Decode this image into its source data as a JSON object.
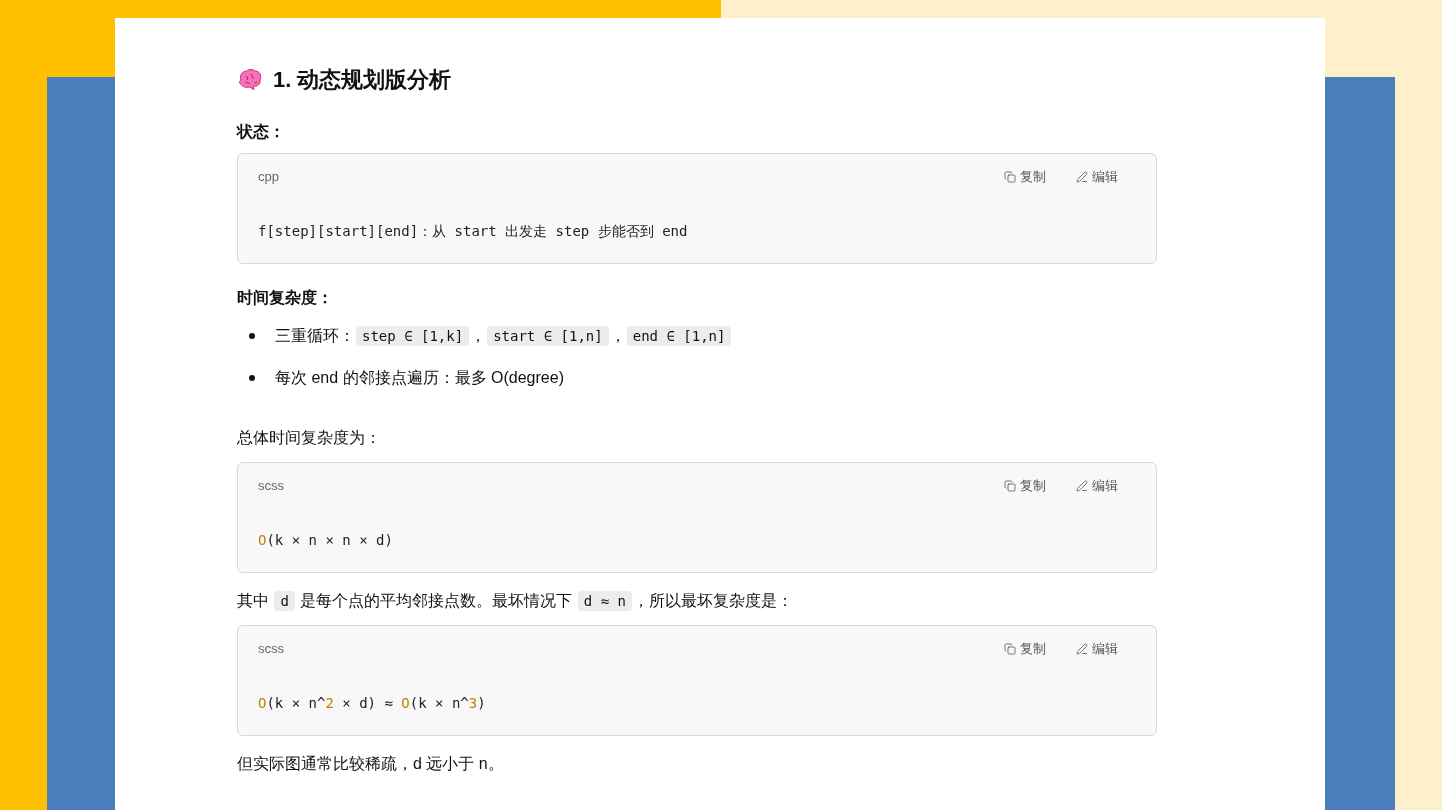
{
  "document": {
    "blocks": [
      {
        "kind": "heading",
        "text": "1. 动态规划版分析"
      },
      {
        "kind": "label",
        "text": "状态："
      },
      {
        "kind": "code",
        "language": "cpp",
        "actions": [
          "复制",
          "编辑"
        ],
        "tokens": [
          {
            "kind": "plain",
            "text": "f[step][start][end]：从 start 出发走 step 步能否到 end"
          }
        ]
      },
      {
        "kind": "label",
        "text": "时间复杂度："
      },
      {
        "kind": "bullets",
        "items": [
          [
            {
              "kind": "text",
              "text": "三重循环："
            },
            {
              "kind": "code",
              "text": "step ∈ [1,k]"
            },
            {
              "kind": "text",
              "text": "，"
            },
            {
              "kind": "code",
              "text": "start ∈ [1,n]"
            },
            {
              "kind": "text",
              "text": "，"
            },
            {
              "kind": "code",
              "text": "end ∈ [1,n]"
            }
          ],
          [
            {
              "kind": "text",
              "text": "每次 end 的邻接点遍历：最多 O(degree)"
            }
          ]
        ]
      },
      {
        "kind": "paragraph",
        "segments": [
          {
            "kind": "text",
            "text": "总体时间复杂度为："
          }
        ]
      },
      {
        "kind": "code",
        "language": "scss",
        "actions": [
          "复制",
          "编辑"
        ],
        "tokens": [
          {
            "kind": "accent",
            "text": "O"
          },
          {
            "kind": "plain",
            "text": "(k × n × n × d)"
          }
        ]
      },
      {
        "kind": "paragraph",
        "segments": [
          {
            "kind": "text",
            "text": "其中 "
          },
          {
            "kind": "code",
            "text": "d"
          },
          {
            "kind": "text",
            "text": " 是每个点的平均邻接点数。最坏情况下 "
          },
          {
            "kind": "code",
            "text": "d ≈ n"
          },
          {
            "kind": "text",
            "text": "，所以最坏复杂度是："
          }
        ]
      },
      {
        "kind": "code",
        "language": "scss",
        "actions": [
          "复制",
          "编辑"
        ],
        "tokens": [
          {
            "kind": "accent",
            "text": "O"
          },
          {
            "kind": "plain",
            "text": "(k × n^"
          },
          {
            "kind": "accent",
            "text": "2"
          },
          {
            "kind": "plain",
            "text": " × d) ≈ "
          },
          {
            "kind": "accent",
            "text": "O"
          },
          {
            "kind": "plain",
            "text": "(k × n^"
          },
          {
            "kind": "accent",
            "text": "3"
          },
          {
            "kind": "plain",
            "text": ")"
          }
        ]
      },
      {
        "kind": "paragraph",
        "segments": [
          {
            "kind": "text",
            "text": "但实际图通常比较稀疏，d 远小于 n。"
          }
        ]
      }
    ]
  }
}
